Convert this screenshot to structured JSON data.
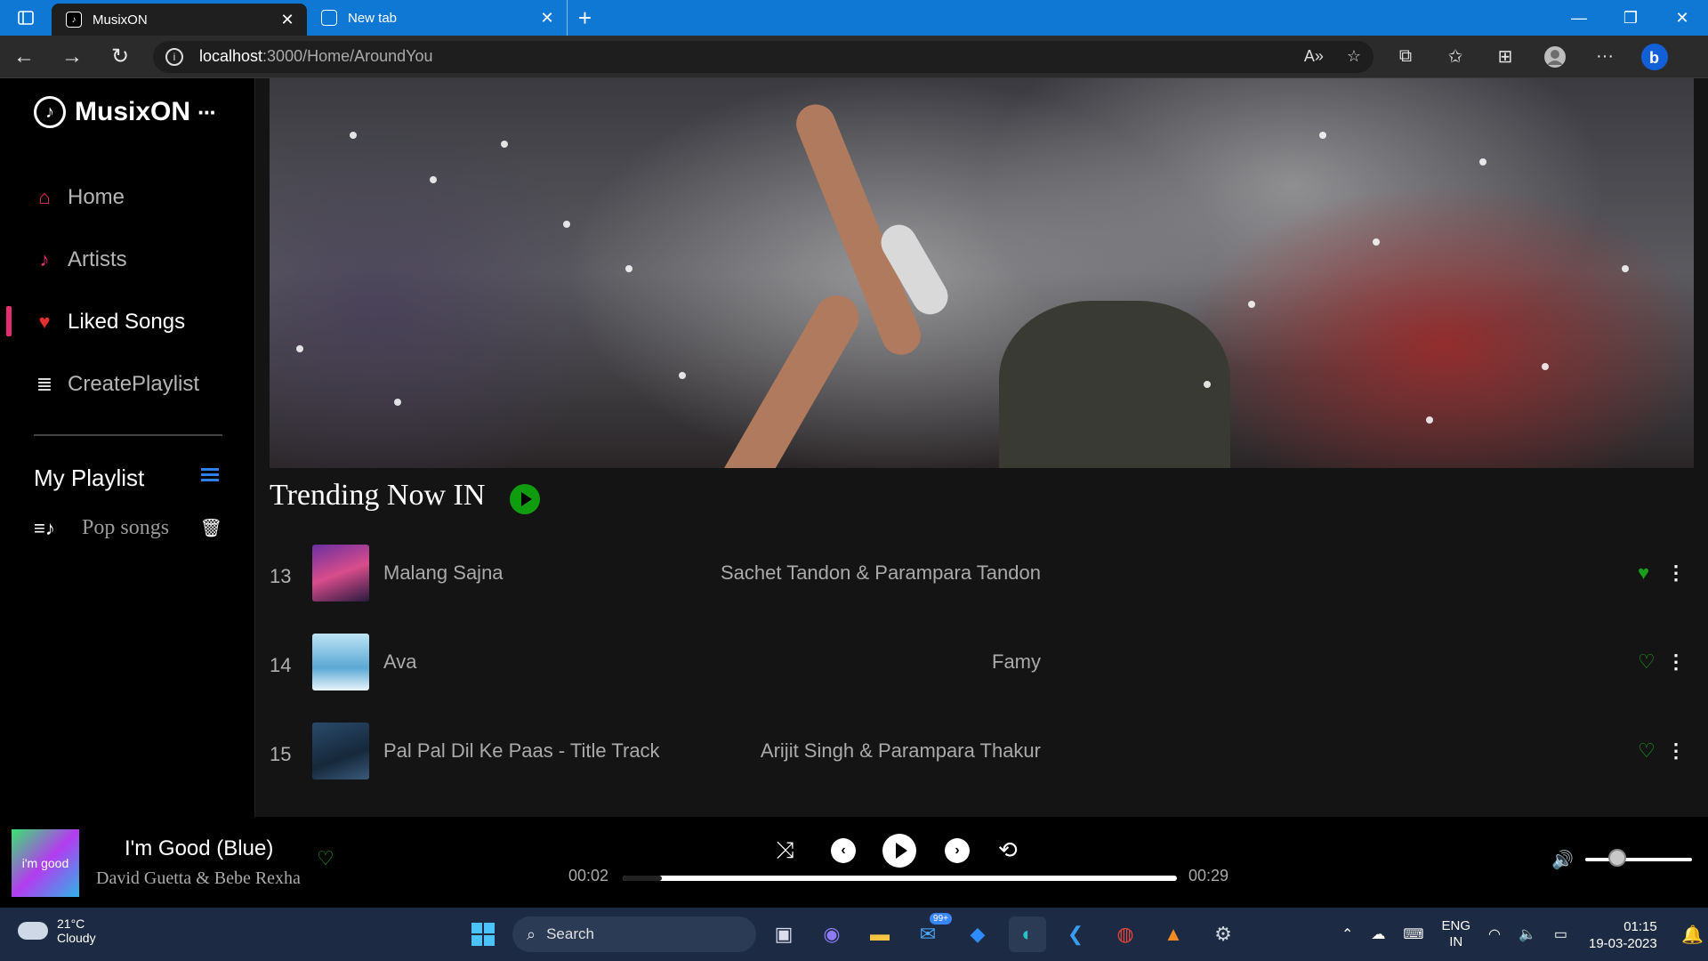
{
  "browser": {
    "tabs": [
      {
        "label": "MusixON",
        "active": true
      },
      {
        "label": "New tab",
        "active": false
      }
    ],
    "url_host": "localhost",
    "url_path": ":3000/Home/AroundYou"
  },
  "sidebar": {
    "brand": "MusixON",
    "brand_more": "···",
    "items": [
      {
        "label": "Home",
        "icon": "home-icon"
      },
      {
        "label": "Artists",
        "icon": "music-note-icon"
      },
      {
        "label": "Liked Songs",
        "icon": "heart-icon",
        "active": true
      },
      {
        "label": "CreatePlaylist",
        "icon": "add-playlist-icon"
      }
    ],
    "my_playlist": "My Playlist",
    "playlists": [
      {
        "name": "Pop songs"
      }
    ]
  },
  "main": {
    "trending_title": "Trending Now IN",
    "songs": [
      {
        "number": "13",
        "name": "Malang Sajna",
        "artist": "Sachet Tandon & Parampara Tandon",
        "liked": true
      },
      {
        "number": "14",
        "name": "Ava",
        "artist": "Famy",
        "liked": false
      },
      {
        "number": "15",
        "name": "Pal Pal Dil Ke Paas - Title Track",
        "artist": "Arijit Singh & Parampara Thakur",
        "liked": false
      }
    ]
  },
  "player": {
    "title": "I'm Good (Blue)",
    "artist": "David Guetta & Bebe Rexha",
    "art_text": "i'm good",
    "current_time": "00:02",
    "total_time": "00:29",
    "progress_fraction": 0.07,
    "volume_fraction": 0.3
  },
  "taskbar": {
    "temp": "21°C",
    "condition": "Cloudy",
    "search_label": "Search",
    "mail_badge": "99+",
    "lang_top": "ENG",
    "lang_bottom": "IN",
    "time": "01:15",
    "date": "19-03-2023"
  },
  "colors": {
    "accent_green": "#0f9d0f",
    "active_pink": "#e52e71",
    "playlist_blue": "#2f7fe9",
    "titlebar_blue": "#0f78d4"
  }
}
